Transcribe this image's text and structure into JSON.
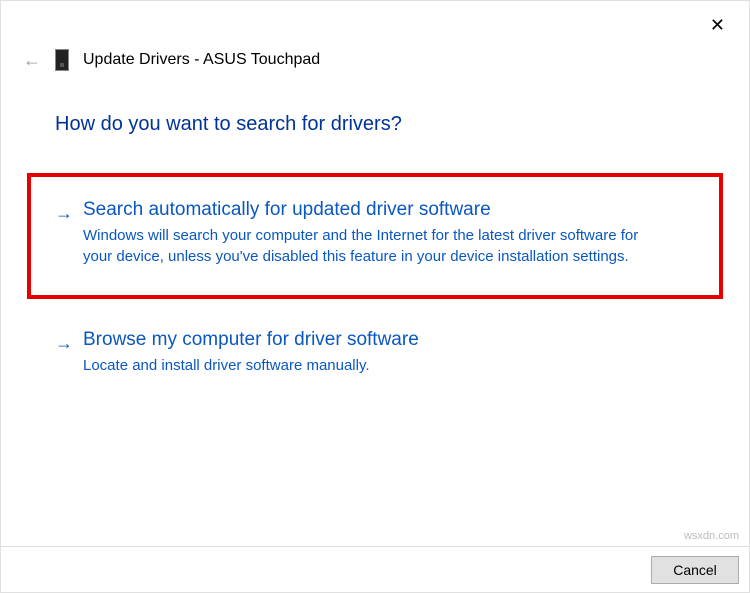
{
  "window": {
    "title": "Update Drivers - ASUS Touchpad"
  },
  "heading": "How do you want to search for drivers?",
  "options": [
    {
      "title": "Search automatically for updated driver software",
      "desc": "Windows will search your computer and the Internet for the latest driver software for your device, unless you've disabled this feature in your device installation settings."
    },
    {
      "title": "Browse my computer for driver software",
      "desc": "Locate and install driver software manually."
    }
  ],
  "buttons": {
    "cancel": "Cancel"
  },
  "watermark": "wsxdn.com"
}
